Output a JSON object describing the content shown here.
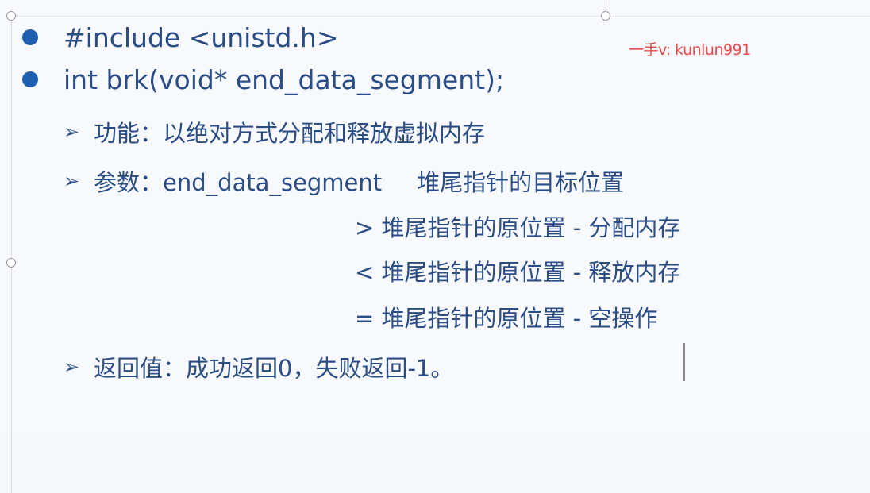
{
  "lines": {
    "include": "#include <unistd.h>",
    "prototype": "int brk(void* end_data_segment);"
  },
  "details": {
    "function_text": "功能：以绝对方式分配和释放虚拟内存",
    "params_label": "参数：end_data_segment",
    "params_desc": "堆尾指针的目标位置",
    "cond_greater": "> 堆尾指针的原位置 - 分配内存",
    "cond_less": "< 堆尾指针的原位置 - 释放内存",
    "cond_equal": "= 堆尾指针的原位置 - 空操作",
    "return_text": "返回值：成功返回0，失败返回-1。"
  },
  "watermark": "一手v: kunlun991",
  "colors": {
    "text": "#2a4d86",
    "bullet": "#1f5fb0",
    "watermark": "#e8494a"
  },
  "icons": {
    "bullet": "filled-circle",
    "sub_bullet": "arrow-right"
  }
}
